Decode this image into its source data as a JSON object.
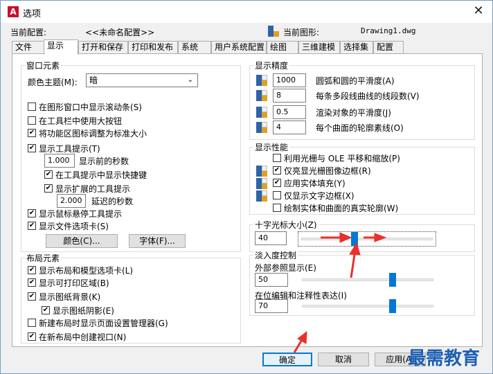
{
  "window": {
    "title": "选项",
    "app_icon": "A",
    "close": "✕"
  },
  "header": {
    "profile_label": "当前配置:",
    "profile_value": "<<未命名配置>>",
    "drawing_label": "当前图形:",
    "drawing_value": "Drawing1.dwg"
  },
  "tabs": [
    "文件",
    "显示",
    "打开和保存",
    "打印和发布",
    "系统",
    "用户系统配置",
    "绘图",
    "三维建模",
    "选择集",
    "配置"
  ],
  "active_tab": "显示",
  "window_elements": {
    "title": "窗口元素",
    "theme_label": "颜色主题(M):",
    "theme_value": "暗",
    "checkboxes": [
      {
        "label": "在图形窗口中显示滚动条(S)",
        "checked": false
      },
      {
        "label": "在工具栏中使用大按钮",
        "checked": false
      },
      {
        "label": "将功能区图标调整为标准大小",
        "checked": true
      },
      {
        "label": "显示工具提示(T)",
        "checked": true
      }
    ],
    "tooltip_delay_value": "1.000",
    "tooltip_delay_label": "显示前的秒数",
    "shortcut_label": "在工具提示中显示快捷键",
    "shortcut_checked": true,
    "extended_label": "显示扩展的工具提示",
    "extended_checked": true,
    "extended_delay_value": "2.000",
    "extended_delay_label": "延迟的秒数",
    "rollover_label": "显示鼠标悬停工具提示",
    "rollover_checked": true,
    "filetabs_label": "显示文件选项卡(S)",
    "filetabs_checked": true,
    "colors_button": "颜色(C)...",
    "fonts_button": "字体(F)..."
  },
  "layout_elements": {
    "title": "布局元素",
    "checkboxes": [
      {
        "label": "显示布局和模型选项卡(L)",
        "checked": true
      },
      {
        "label": "显示可打印区域(B)",
        "checked": true
      },
      {
        "label": "显示图纸背景(K)",
        "checked": true
      },
      {
        "label": "显示图纸阴影(E)",
        "checked": true
      },
      {
        "label": "新建布局时显示页面设置管理器(G)",
        "checked": false
      },
      {
        "label": "在新布局中创建视口(N)",
        "checked": true
      }
    ]
  },
  "display_resolution": {
    "title": "显示精度",
    "rows": [
      {
        "value": "1000",
        "label": "圆弧和圆的平滑度(A)"
      },
      {
        "value": "8",
        "label": "每条多段线曲线的线段数(V)"
      },
      {
        "value": "0.5",
        "label": "渲染对象的平滑度(J)"
      },
      {
        "value": "4",
        "label": "每个曲面的轮廓素线(O)"
      }
    ]
  },
  "display_performance": {
    "title": "显示性能",
    "items": [
      {
        "label": "利用光栅与 OLE 平移和缩放(P)",
        "checked": false,
        "icon": false
      },
      {
        "label": "仅亮显光栅图像边框(R)",
        "checked": true,
        "icon": true
      },
      {
        "label": "应用实体填充(Y)",
        "checked": true,
        "icon": true
      },
      {
        "label": "仅显示文字边框(X)",
        "checked": false,
        "icon": true
      },
      {
        "label": "绘制实体和曲面的真实轮廓(W)",
        "checked": false,
        "icon": false
      }
    ]
  },
  "crosshair": {
    "title": "十字光标大小(Z)",
    "value": "40",
    "slider_level": 0.4
  },
  "fade": {
    "title": "淡入度控制",
    "xref_label": "外部参照显示(E)",
    "xref_value": "50",
    "xref_level": 0.7,
    "inplace_label": "在位编辑和注释性表达(I)",
    "inplace_value": "70",
    "inplace_level": 0.7
  },
  "buttons": {
    "ok": "确定",
    "cancel": "取消",
    "apply": "应用(A)"
  },
  "watermark": "最需教育",
  "colors": {
    "accent": "#0078d7",
    "arrow": "#e8312a",
    "watermark": "#1d5fb5"
  }
}
